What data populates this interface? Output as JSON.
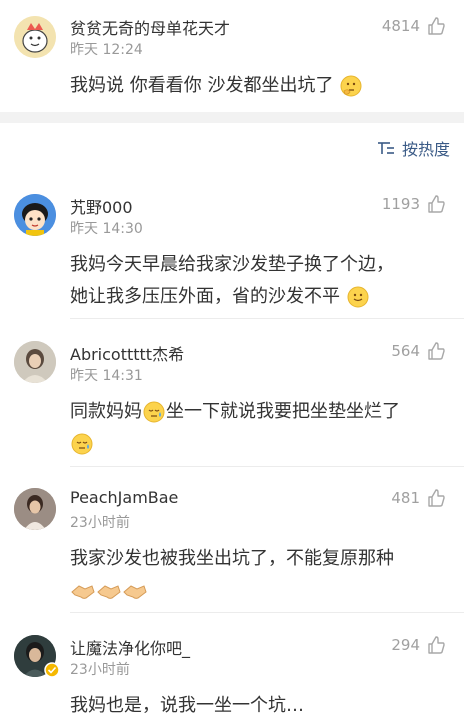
{
  "original_post": {
    "author": "贫贫无奇的母单花天才",
    "time": "昨天 12:24",
    "likes": "4814",
    "text": "我妈说 你看看你 沙发都坐出坑了"
  },
  "sort_label": "按热度",
  "comments": [
    {
      "author": "艽野000",
      "time": "昨天 14:30",
      "likes": "1193",
      "line1": "我妈今天早晨给我家沙发垫子换了个边，",
      "line2": "她让我多压压外面，省的沙发不平"
    },
    {
      "author": "Abricottttt杰希",
      "time": "昨天 14:31",
      "likes": "564",
      "line1": "同款妈妈",
      "line1b": "坐一下就说我要把坐垫坐烂了",
      "line2": ""
    },
    {
      "author": "PeachJamBae",
      "time": "23小时前",
      "likes": "481",
      "line1": "我家沙发也被我坐出坑了，不能复原那种",
      "line2": ""
    },
    {
      "author": "让魔法净化你吧_",
      "time": "23小时前",
      "likes": "294",
      "line1": "我妈也是，说我一坐一个坑…",
      "line2": ""
    }
  ]
}
